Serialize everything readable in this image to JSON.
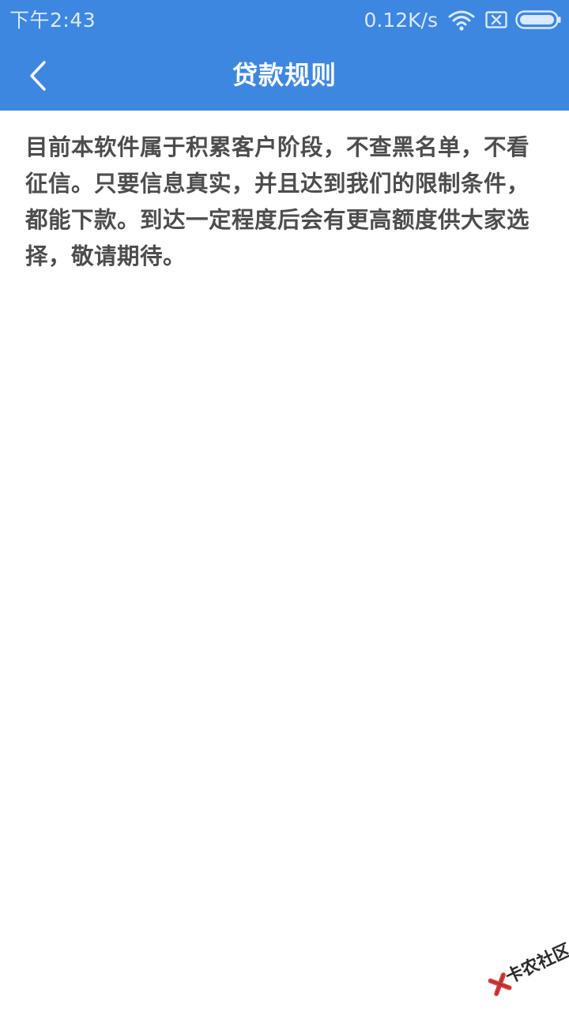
{
  "status_bar": {
    "time": "下午2:43",
    "network_speed": "0.12K/s",
    "icons": [
      "wifi-icon",
      "sim-icon",
      "battery-icon"
    ]
  },
  "header": {
    "title": "贷款规则",
    "back_icon": "chevron-left-icon",
    "background_color": "#3d87e0"
  },
  "main": {
    "rules_text": "目前本软件属于积累客户阶段，不查黑名单，不看征信。只要信息真实，并且达到我们的限制条件，都能下款。到达一定程度后会有更高额度供大家选择，敬请期待。"
  },
  "watermark": {
    "text": "卡农社区",
    "icon": "x-logo-icon",
    "accent_color": "#e23b3b"
  }
}
